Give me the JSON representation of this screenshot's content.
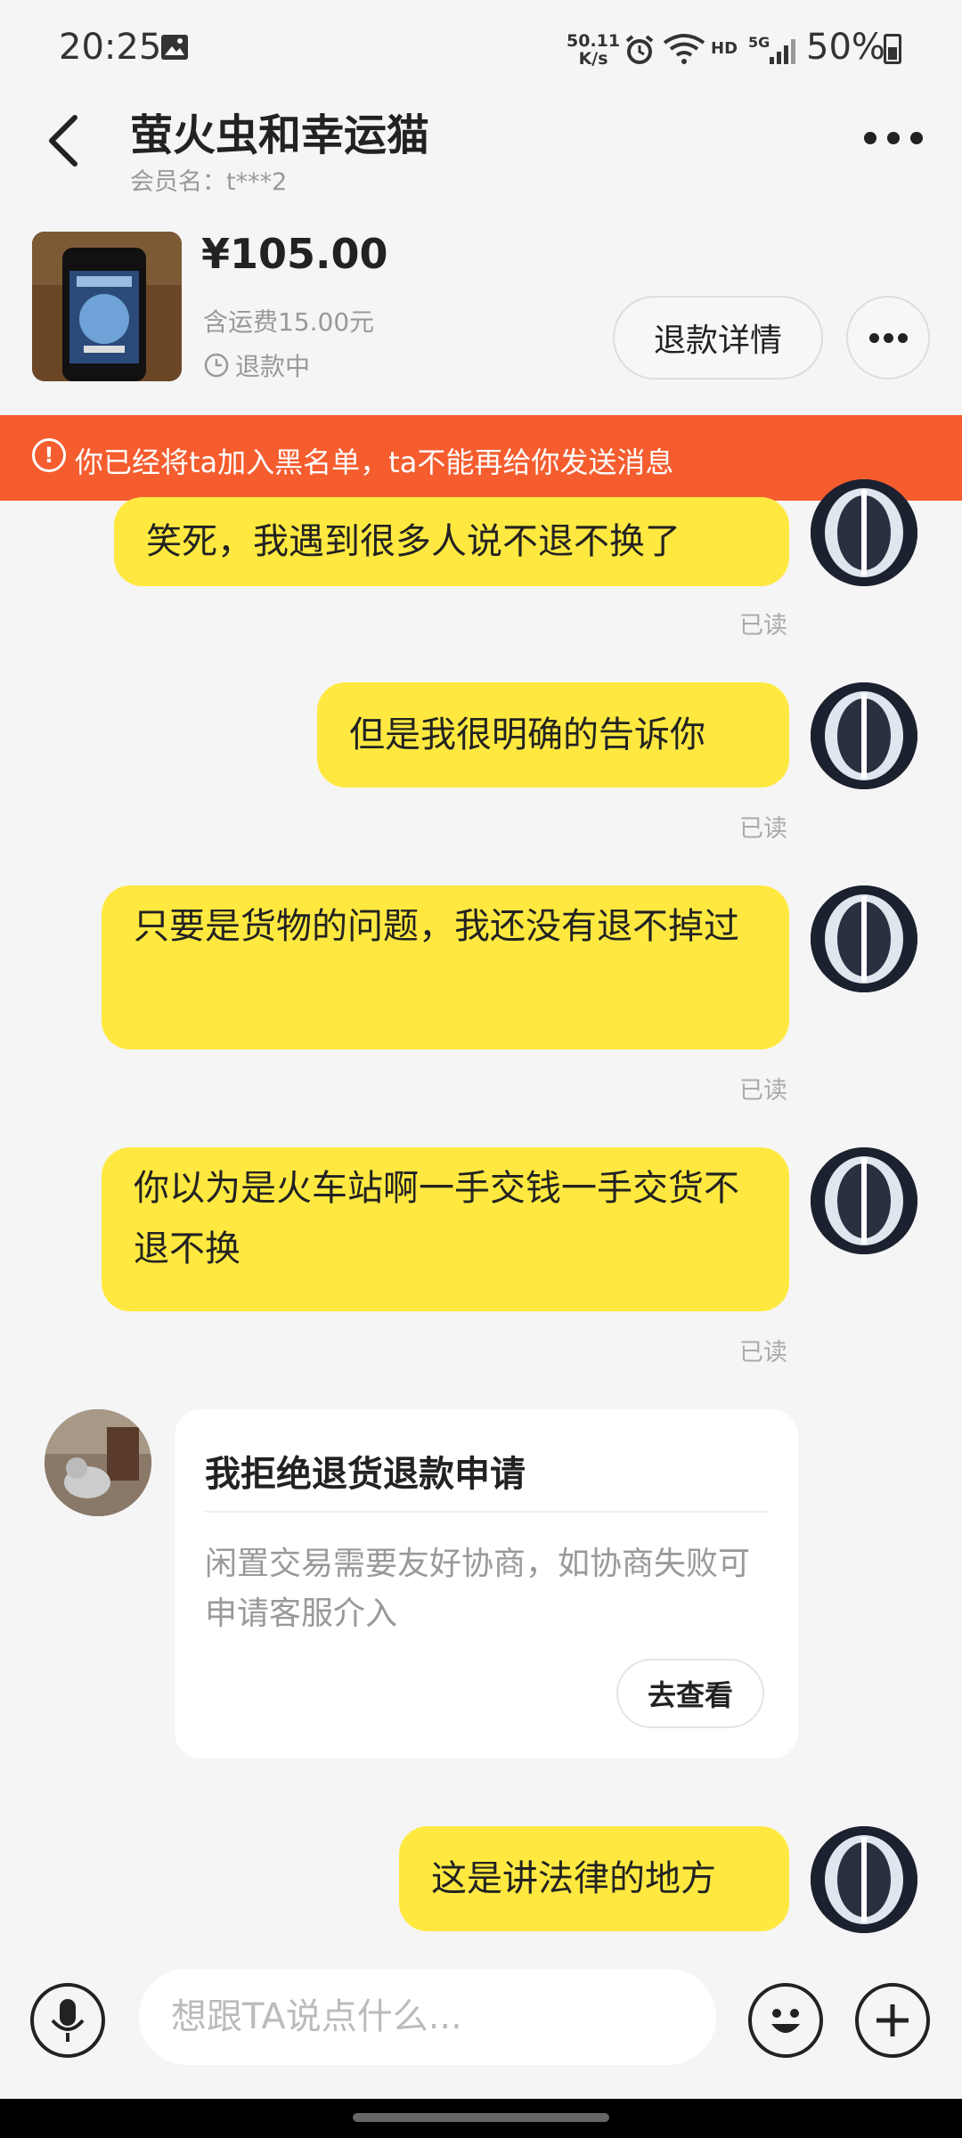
{
  "status_bar": {
    "time": "20:25",
    "net_speed_value": "50.11",
    "net_speed_unit": "K/s",
    "network_label": "HD",
    "signal_label": "5G",
    "battery": "50%"
  },
  "header": {
    "title": "萤火虫和幸运猫",
    "member_label": "会员名：t***2"
  },
  "product": {
    "price": "¥105.00",
    "shipping": "含运费15.00元",
    "status": "退款中",
    "refund_button": "退款详情"
  },
  "banner": {
    "icon": "!",
    "text": "你已经将ta加入黑名单，ta不能再给你发送消息"
  },
  "messages": [
    {
      "text": "笑死，我遇到很多人说不退不换了",
      "read": "已读"
    },
    {
      "text": "但是我很明确的告诉你",
      "read": "已读"
    },
    {
      "text": "只要是货物的问题，我还没有退不掉过",
      "read": "已读"
    },
    {
      "text": "你以为是火车站啊一手交钱一手交货不退不换",
      "read": "已读"
    }
  ],
  "card": {
    "title": "我拒绝退货退款申请",
    "description": "闲置交易需要友好协商，如协商失败可申请客服介入",
    "button": "去查看"
  },
  "last_message": {
    "text": "这是讲法律的地方"
  },
  "input": {
    "placeholder": "想跟TA说点什么..."
  },
  "icons": [
    "back-arrow-icon",
    "more-icon",
    "image-icon",
    "alarm-icon",
    "wifi-icon",
    "signal-icon",
    "battery-icon",
    "clock-icon",
    "alert-icon",
    "microphone-icon",
    "emoji-icon",
    "plus-icon"
  ],
  "colors": {
    "bubble": "#ffe940",
    "banner": "#f55d2f",
    "background": "#f5f5f5"
  }
}
